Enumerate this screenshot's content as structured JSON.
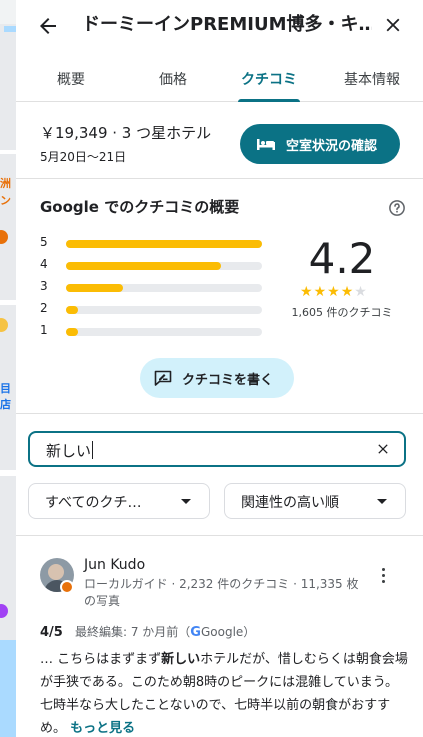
{
  "header": {
    "title": "ドーミーインPREMIUM博多・キ…",
    "back_icon": "arrow-left-icon",
    "close_icon": "close-icon"
  },
  "tabs": [
    {
      "label": "概要",
      "active": false
    },
    {
      "label": "価格",
      "active": false
    },
    {
      "label": "クチコミ",
      "active": true
    },
    {
      "label": "基本情報",
      "active": false
    }
  ],
  "hotel": {
    "price_line": "￥19,349 · 3 つ星ホテル",
    "dates": "5月20日〜21日",
    "check_availability_label": "空室状況の確認",
    "bed_icon": "bed-icon"
  },
  "summary": {
    "heading": "Google でのクチコミの概要",
    "help_icon": "help-circle-icon",
    "distribution": [
      {
        "stars": "5",
        "fraction": 1.0
      },
      {
        "stars": "4",
        "fraction": 0.79
      },
      {
        "stars": "3",
        "fraction": 0.29
      },
      {
        "stars": "2",
        "fraction": 0.06
      },
      {
        "stars": "1",
        "fraction": 0.06
      }
    ],
    "rating": "4.2",
    "stars_filled": 4,
    "stars_total": 5,
    "review_count": "1,605 件のクチコミ",
    "write_review_label": "クチコミを書く",
    "write_icon": "rate-review-icon"
  },
  "search": {
    "value": "新しい",
    "clear_icon": "close-icon"
  },
  "filters": {
    "type_label": "すべてのクチ…",
    "sort_label": "関連性の高い順"
  },
  "review": {
    "name": "Jun Kudo",
    "meta": "ローカルガイド · 2,232 件のクチコミ · 11,335 枚の写真",
    "score": "4/5",
    "edited": "最終編集: 7 か月前（",
    "source": "Google",
    "source_close": "）",
    "text_before": "… こちらはまずまず",
    "text_highlight": "新しい",
    "text_after": "ホテルだが、惜しむらくは朝食会場が手狭である。このため朝8時のピークには混雑していまう。七時半なら大したことないので、七時半以前の朝食がおすすめ。",
    "more_label": "もっと見る",
    "more_icon": "more-vert-icon",
    "guide_badge_icon": "local-guide-badge-icon"
  },
  "colors": {
    "accent": "#0b7285",
    "star": "#fbbc04",
    "chip": "#d2f1fb"
  }
}
